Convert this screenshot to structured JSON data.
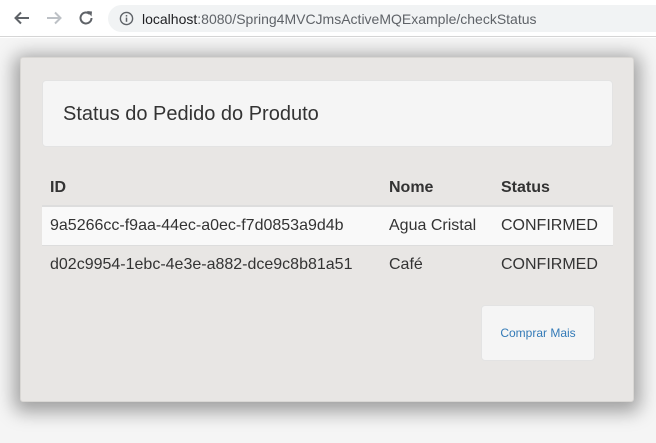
{
  "browser": {
    "url_host": "localhost",
    "url_rest": ":8080/Spring4MVCJmsActiveMQExample/checkStatus"
  },
  "panel": {
    "title": "Status do Pedido do Produto"
  },
  "table": {
    "headers": [
      "ID",
      "Nome",
      "Status"
    ],
    "rows": [
      [
        "9a5266cc-f9aa-44ec-a0ec-f7d0853a9d4b",
        "Agua Cristal",
        "CONFIRMED"
      ],
      [
        "d02c9954-1ebc-4e3e-a882-dce9c8b81a51",
        "Café",
        "CONFIRMED"
      ]
    ]
  },
  "actions": {
    "buy_more_label": "Comprar Mais"
  },
  "colors": {
    "link": "#337ab7",
    "panel_bg": "#e8e6e4"
  }
}
